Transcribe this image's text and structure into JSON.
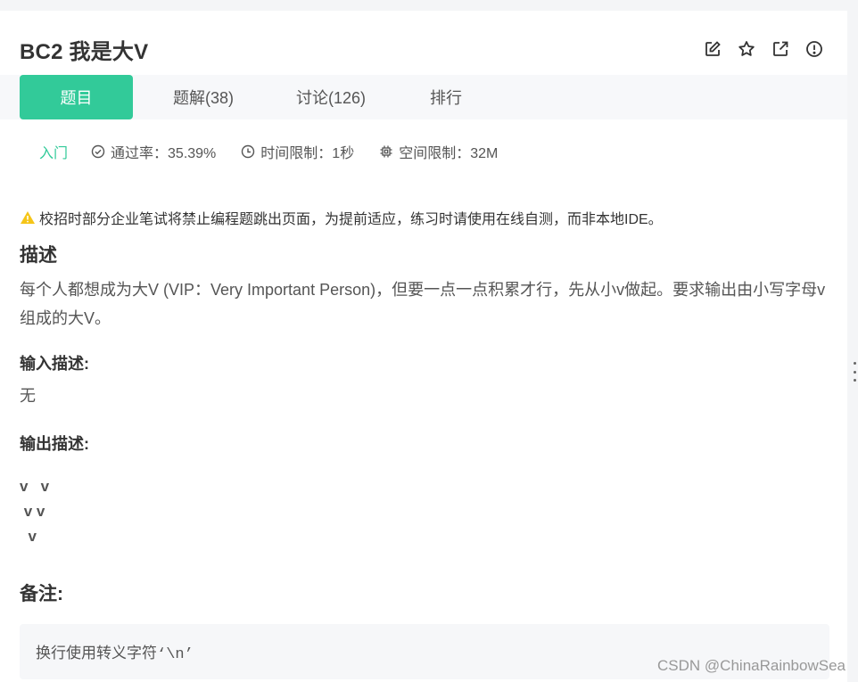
{
  "problem": {
    "title": "BC2  我是大V"
  },
  "actions": [
    {
      "name": "edit-icon"
    },
    {
      "name": "star-icon"
    },
    {
      "name": "share-icon"
    },
    {
      "name": "report-icon"
    }
  ],
  "tabs": [
    {
      "label": "题目",
      "active": true
    },
    {
      "label": "题解(38)",
      "active": false
    },
    {
      "label": "讨论(126)",
      "active": false
    },
    {
      "label": "排行",
      "active": false
    }
  ],
  "meta": {
    "level": "入门",
    "pass_rate": "通过率：35.39%",
    "time_limit": "时间限制：1秒",
    "space_limit": "空间限制：32M"
  },
  "notice": "校招时部分企业笔试将禁止编程题跳出页面，为提前适应，练习时请使用在线自测，而非本地IDE。",
  "description": {
    "heading": "描述",
    "text": "每个人都想成为大V (VIP：Very Important Person)，但要一点一点积累才行，先从小v做起。要求输出由小写字母v组成的大V。"
  },
  "input": {
    "heading": "输入描述:",
    "text": "无"
  },
  "output": {
    "heading": "输出描述:",
    "text": "v   v\n v v\n  v"
  },
  "remark": {
    "heading": "备注:",
    "text": "换行使用转义字符‘\\n’"
  },
  "watermark": "CSDN @ChinaRainbowSea",
  "colors": {
    "accent": "#32ca99",
    "warning": "#f5c518"
  }
}
